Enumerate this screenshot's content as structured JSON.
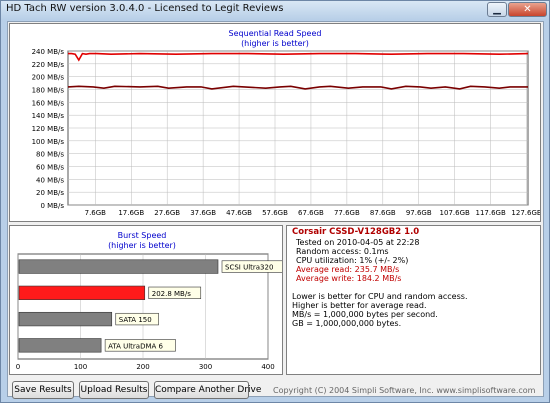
{
  "window": {
    "title": "HD Tach RW version 3.0.4.0 - Licensed to Legit Reviews",
    "minimize_glyph": "▁",
    "close_glyph": "✕"
  },
  "read_chart": {
    "title": "Sequential Read Speed",
    "subtitle": "(higher is better)"
  },
  "burst_chart": {
    "title": "Burst Speed",
    "subtitle": "(higher is better)"
  },
  "info": {
    "drive_name": "Corsair CSSD-V128GB2 1.0",
    "tested_on": "Tested on 2010-04-05 at 22:28",
    "random_access": "Random access: 0.1ms",
    "cpu_util": "CPU utilization: 1% (+/- 2%)",
    "avg_read": "Average read: 235.7 MB/s",
    "avg_write": "Average write: 184.2 MB/s",
    "note1": "Lower is better for CPU and random access.",
    "note2": "Higher is better for average read.",
    "note3": "MB/s = 1,000,000 bytes per second.",
    "note4": "GB = 1,000,000,000 bytes."
  },
  "buttons": {
    "save": "Save Results",
    "upload": "Upload Results",
    "compare": "Compare Another Drive"
  },
  "copyright": "Copyright (C) 2004 Simpli Software, Inc. www.simplisoftware.com",
  "colors": {
    "read_line": "#e00000",
    "write_line": "#7a0000",
    "current_bar": "#ff1a1a",
    "ref_bar": "#808080",
    "info_title": "#b00000",
    "avg_text": "#c00000"
  },
  "chart_data": [
    {
      "type": "line",
      "title": "Sequential Read Speed",
      "subtitle": "(higher is better)",
      "ylim": [
        0,
        240
      ],
      "yticks": [
        0,
        20,
        40,
        60,
        80,
        100,
        120,
        140,
        160,
        180,
        200,
        220,
        240
      ],
      "ytick_labels": [
        "0 MB/s",
        "20 MB/s",
        "40 MB/s",
        "60 MB/s",
        "80 MB/s",
        "100 MB/s",
        "120 MB/s",
        "140 MB/s",
        "160 MB/s",
        "180 MB/s",
        "200 MB/s",
        "220 MB/s",
        "240 MB/s"
      ],
      "xlim": [
        0,
        128
      ],
      "xticks": [
        7.6,
        17.6,
        27.6,
        37.6,
        47.6,
        57.6,
        67.6,
        77.6,
        87.6,
        97.6,
        107.6,
        117.6,
        127.6
      ],
      "xtick_labels": [
        "7.6GB",
        "17.6GB",
        "27.6GB",
        "37.6GB",
        "47.6GB",
        "57.6GB",
        "67.6GB",
        "77.6GB",
        "87.6GB",
        "97.6GB",
        "107.6GB",
        "117.6GB",
        "127.6GB"
      ],
      "grid": true,
      "series": [
        {
          "name": "",
          "x": [
            0,
            1,
            2,
            3,
            4,
            5,
            6,
            8,
            12,
            20,
            30,
            40,
            50,
            60,
            70,
            80,
            90,
            100,
            110,
            120,
            128
          ],
          "values": [
            236,
            236,
            235,
            226,
            236,
            235,
            236,
            236,
            235,
            236,
            235,
            236,
            236,
            235,
            236,
            236,
            235,
            236,
            236,
            235,
            236
          ]
        },
        {
          "name": "",
          "x": [
            0,
            3,
            7,
            10,
            13,
            20,
            25,
            28,
            33,
            37,
            40,
            46,
            49,
            55,
            59,
            62,
            66,
            70,
            73,
            78,
            82,
            87,
            90,
            94,
            98,
            101,
            105,
            109,
            112,
            116,
            120,
            123,
            128
          ],
          "values": [
            184,
            185,
            184,
            182,
            185,
            184,
            185,
            182,
            184,
            184,
            181,
            185,
            184,
            182,
            184,
            185,
            181,
            184,
            185,
            182,
            184,
            184,
            181,
            185,
            184,
            182,
            184,
            181,
            185,
            184,
            182,
            184,
            184
          ]
        }
      ]
    },
    {
      "type": "bar",
      "orientation": "horizontal",
      "title": "Burst Speed",
      "subtitle": "(higher is better)",
      "xlim": [
        0,
        400
      ],
      "xticks": [
        0,
        100,
        200,
        300,
        400
      ],
      "xtick_labels": [
        "0",
        "100",
        "200",
        "300",
        "400"
      ],
      "categories": [
        "SCSI Ultra320",
        "202.8 MB/s",
        "SATA 150",
        "ATA UltraDMA 6"
      ],
      "values": [
        320,
        202.8,
        150,
        133
      ],
      "highlight_index": 1
    }
  ]
}
